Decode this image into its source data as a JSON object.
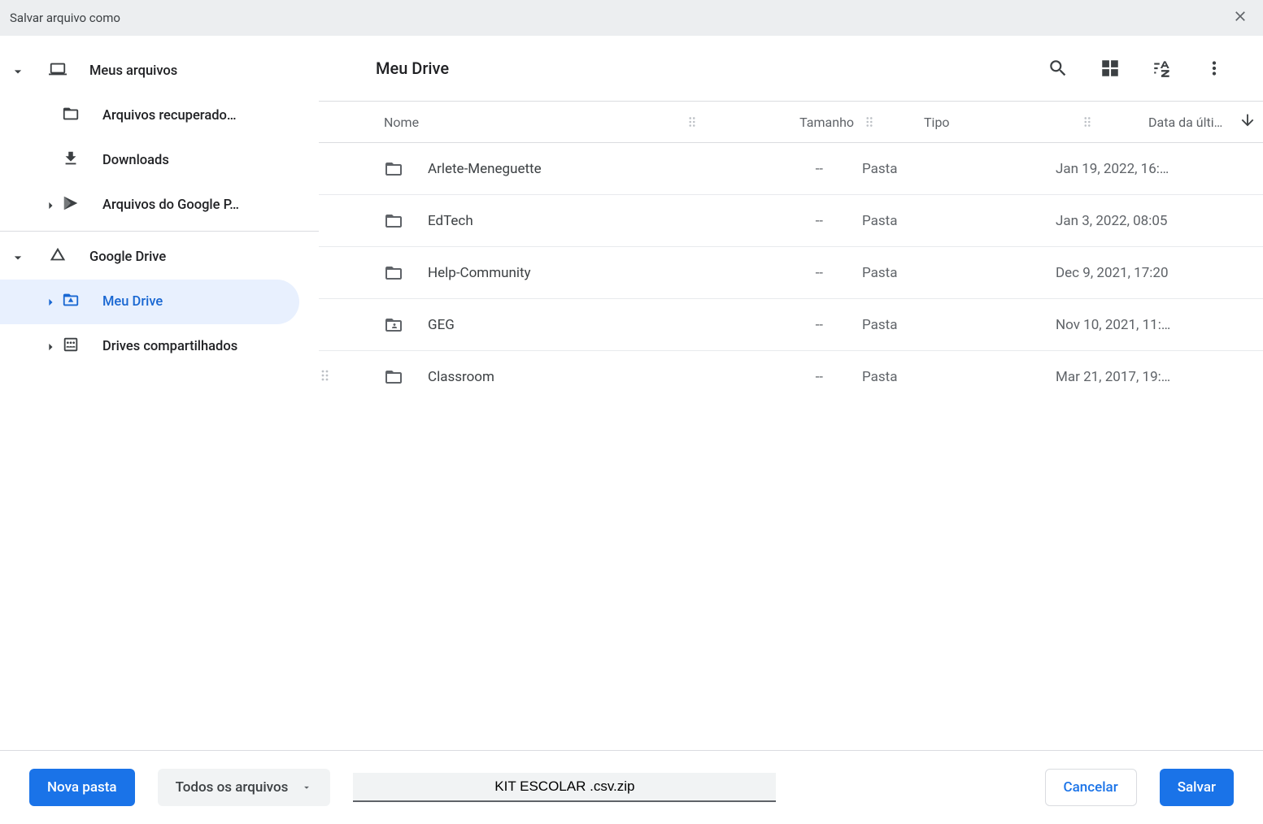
{
  "dialog": {
    "title": "Salvar arquivo como"
  },
  "sidebar": {
    "my_files": "Meus arquivos",
    "recovered": "Arquivos recuperado…",
    "downloads": "Downloads",
    "play_files": "Arquivos do Google P…",
    "gdrive": "Google Drive",
    "my_drive": "Meu Drive",
    "shared_drives": "Drives compartilhados"
  },
  "main": {
    "breadcrumb": "Meu Drive",
    "columns": {
      "nome": "Nome",
      "tamanho": "Tamanho",
      "tipo": "Tipo",
      "data": "Data da últi…"
    },
    "rows": [
      {
        "name": "Arlete-Meneguette",
        "size": "--",
        "type": "Pasta",
        "date": "Jan 19, 2022, 16:…",
        "icon": "folder"
      },
      {
        "name": "EdTech",
        "size": "--",
        "type": "Pasta",
        "date": "Jan 3, 2022, 08:05",
        "icon": "folder"
      },
      {
        "name": "Help-Community",
        "size": "--",
        "type": "Pasta",
        "date": "Dec 9, 2021, 17:20",
        "icon": "folder"
      },
      {
        "name": "GEG",
        "size": "--",
        "type": "Pasta",
        "date": "Nov 10, 2021, 11:…",
        "icon": "folder-shared"
      },
      {
        "name": "Classroom",
        "size": "--",
        "type": "Pasta",
        "date": "Mar 21, 2017, 19:…",
        "icon": "folder"
      }
    ]
  },
  "footer": {
    "new_folder": "Nova pasta",
    "filetype": "Todos os arquivos",
    "filename": "KIT ESCOLAR .csv.zip",
    "cancel": "Cancelar",
    "save": "Salvar"
  }
}
